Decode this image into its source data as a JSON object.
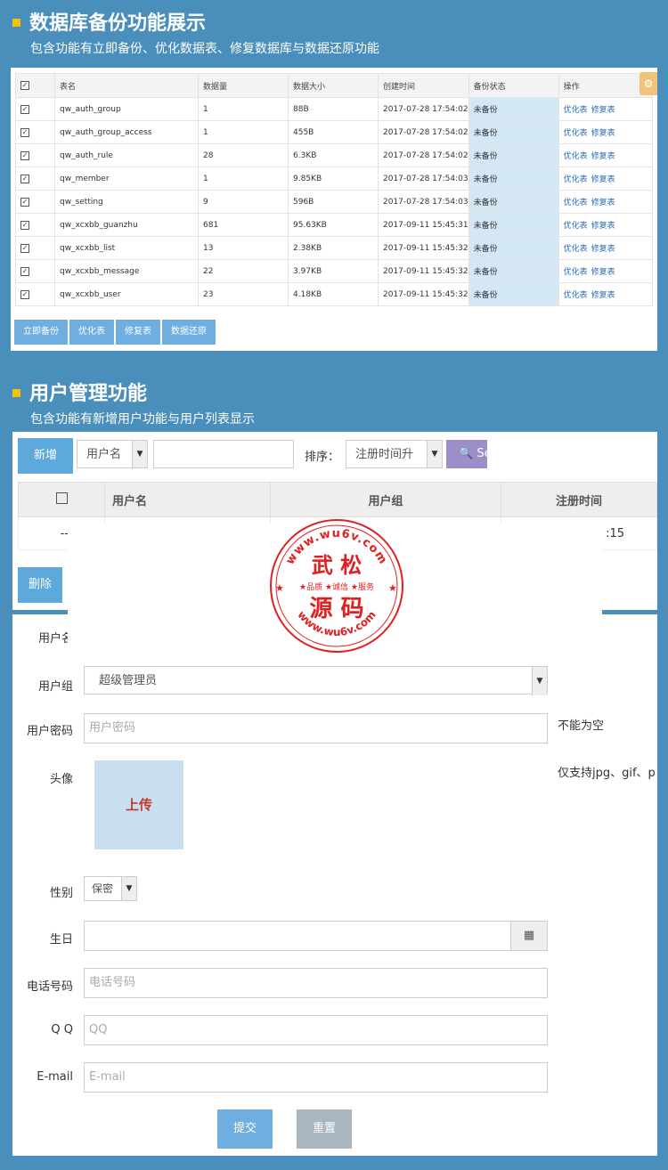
{
  "section1": {
    "title": "数据库备份功能展示",
    "subtitle": "包含功能有立即备份、优化数据表、修复数据库与数据还原功能",
    "columns": [
      "表名",
      "数据量",
      "数据大小",
      "创建时间",
      "备份状态",
      "操作"
    ],
    "rows": [
      {
        "name": "qw_auth_group",
        "count": "1",
        "size": "88B",
        "created": "2017-07-28 17:54:02",
        "status": "未备份"
      },
      {
        "name": "qw_auth_group_access",
        "count": "1",
        "size": "455B",
        "created": "2017-07-28 17:54:02",
        "status": "未备份"
      },
      {
        "name": "qw_auth_rule",
        "count": "28",
        "size": "6.3KB",
        "created": "2017-07-28 17:54:02",
        "status": "未备份"
      },
      {
        "name": "qw_member",
        "count": "1",
        "size": "9.85KB",
        "created": "2017-07-28 17:54:03",
        "status": "未备份"
      },
      {
        "name": "qw_setting",
        "count": "9",
        "size": "596B",
        "created": "2017-07-28 17:54:03",
        "status": "未备份"
      },
      {
        "name": "qw_xcxbb_guanzhu",
        "count": "681",
        "size": "95.63KB",
        "created": "2017-09-11 15:45:31",
        "status": "未备份"
      },
      {
        "name": "qw_xcxbb_list",
        "count": "13",
        "size": "2.38KB",
        "created": "2017-09-11 15:45:32",
        "status": "未备份"
      },
      {
        "name": "qw_xcxbb_message",
        "count": "22",
        "size": "3.97KB",
        "created": "2017-09-11 15:45:32",
        "status": "未备份"
      },
      {
        "name": "qw_xcxbb_user",
        "count": "23",
        "size": "4.18KB",
        "created": "2017-09-11 15:45:32",
        "status": "未备份"
      }
    ],
    "op_optimize": "优化表",
    "op_repair": "修复表",
    "buttons": [
      "立即备份",
      "优化表",
      "修复表",
      "数据还原"
    ]
  },
  "section2": {
    "title": "用户管理功能",
    "subtitle": "包含功能有新增用户功能与用户列表显示",
    "add_label": "新增",
    "field_select": "用户名",
    "sort_label": "排序：",
    "sort_select": "注册时间升",
    "search_label": "Se",
    "columns": [
      "用户名",
      "用户组",
      "注册时间"
    ],
    "row": {
      "first": "--",
      "time": ":15"
    },
    "delete_label": "删除"
  },
  "form": {
    "name_label": "用户名",
    "group_label": "用户组",
    "group_value": "超级管理员",
    "password_label": "用户密码",
    "password_placeholder": "用户密码",
    "password_hint": "不能为空",
    "avatar_label": "头像",
    "upload_label": "上传",
    "avatar_hint": "仅支持jpg、gif、p",
    "gender_label": "性别",
    "gender_value": "保密",
    "birthday_label": "生日",
    "phone_label": "电话号码",
    "phone_placeholder": "电话号码",
    "qq_label": "Q Q",
    "qq_placeholder": "QQ",
    "email_label": "E-mail",
    "email_placeholder": "E-mail",
    "submit_label": "提交",
    "reset_label": "重置"
  },
  "watermark": {
    "url": "www.wu6v.com",
    "name_line1": "武 松",
    "slogan": "★品质 ★诚信 ★服务",
    "name_line2": "源 码"
  },
  "colors": {
    "background": "#4a8fbb",
    "button": "#6eaee0",
    "accent_bullet": "#f5c400",
    "stamp": "#e02020"
  }
}
